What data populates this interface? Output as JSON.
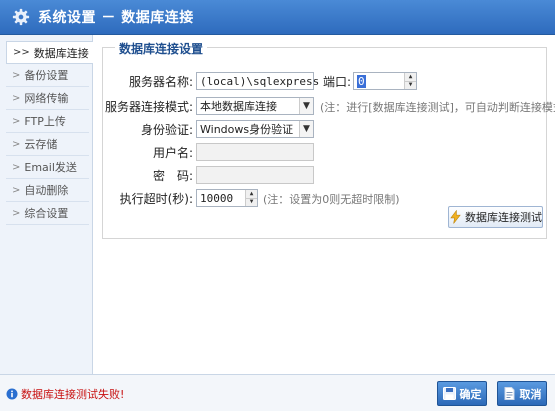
{
  "window": {
    "title": "系统设置 － 数据库连接"
  },
  "sidebar": {
    "items": [
      {
        "label": "数据库连接",
        "active": true
      },
      {
        "label": "备份设置"
      },
      {
        "label": "网络传输"
      },
      {
        "label": "FTP上传"
      },
      {
        "label": "云存储"
      },
      {
        "label": "Email发送"
      },
      {
        "label": "自动删除"
      },
      {
        "label": "综合设置"
      }
    ]
  },
  "group": {
    "title": "数据库连接设置"
  },
  "form": {
    "server_label": "服务器名称:",
    "server_value": "(local)\\sqlexpress",
    "port_label": "端口:",
    "port_value": "0",
    "mode_label": "服务器连接模式:",
    "mode_value": "本地数据库连接",
    "mode_note": "(注：进行[数据库连接测试]，可自动判断连接模式)",
    "auth_label": "身份验证:",
    "auth_value": "Windows身份验证",
    "user_label": "用户名:",
    "user_value": "",
    "pass_label": "密　码:",
    "pass_value": "",
    "timeout_label": "执行超时(秒):",
    "timeout_value": "10000",
    "timeout_note": "(注：设置为0则无超时限制)"
  },
  "buttons": {
    "test": "数据库连接测试",
    "ok": "确定",
    "cancel": "取消"
  },
  "status": {
    "message": "数据库连接测试失败!"
  }
}
